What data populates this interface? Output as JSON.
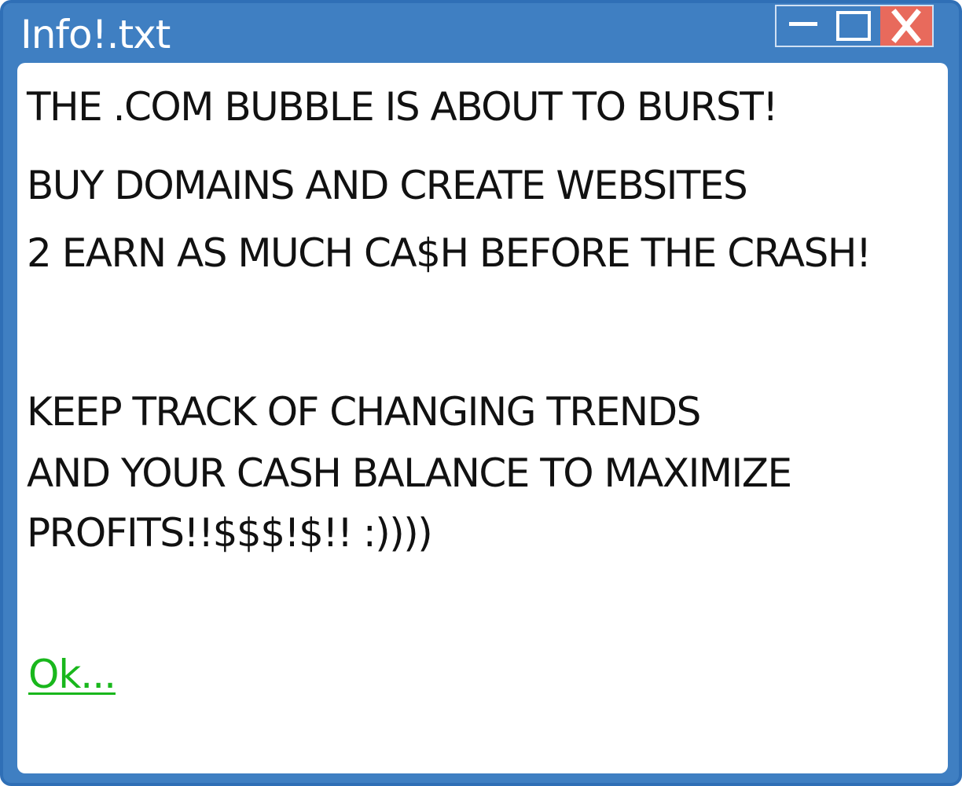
{
  "window": {
    "title": "Info!.txt",
    "controls": {
      "minimize": "minimize-icon",
      "maximize": "maximize-icon",
      "close": "close-icon"
    },
    "colors": {
      "frame": "#3f7fc2",
      "close_button": "#e86a5c",
      "link": "#19b71c"
    }
  },
  "message": {
    "lines": [
      "THE .COM BUBBLE IS ABOUT TO BURST!",
      "BUY DOMAINS AND CREATE WEBSITES",
      "2 EARN AS MUCH CA$H BEFORE THE CRASH!",
      "KEEP TRACK OF CHANGING TRENDS",
      "AND YOUR CASH BALANCE TO MAXIMIZE",
      "PROFITS!!$$$!$!!  :))))"
    ]
  },
  "ok_link": {
    "label": "Ok..."
  }
}
